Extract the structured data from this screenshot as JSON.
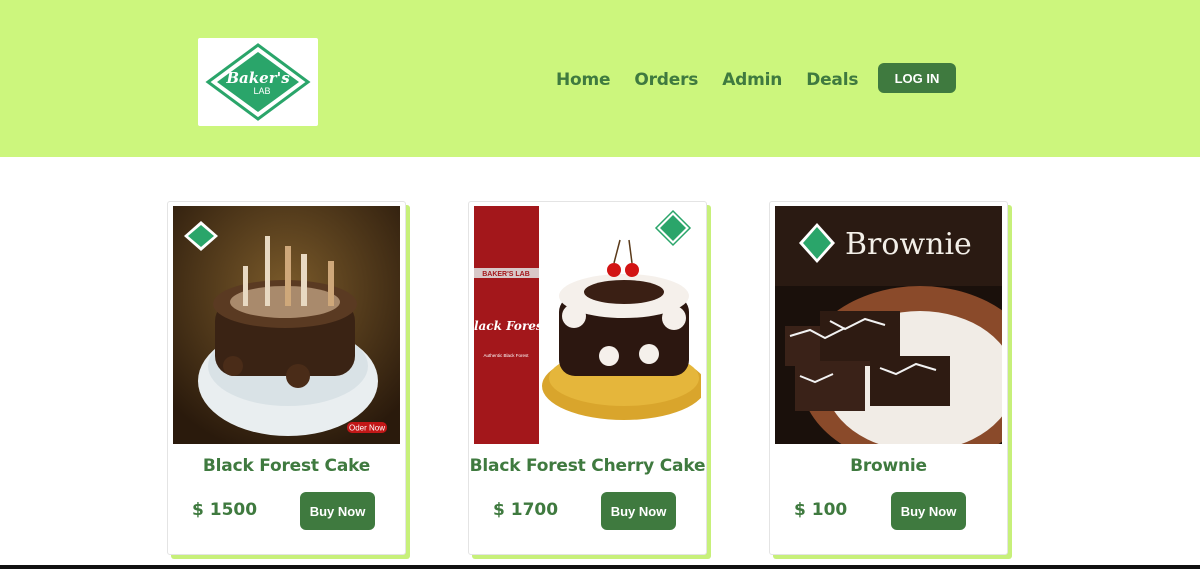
{
  "brand": {
    "logo_line1": "Baker's",
    "logo_line2": "LAB"
  },
  "nav": [
    {
      "label": "Home"
    },
    {
      "label": "Orders"
    },
    {
      "label": "Admin"
    },
    {
      "label": "Deals"
    }
  ],
  "login_label": "LOG IN",
  "colors": {
    "header_bg": "#ccf67d",
    "accent": "#3f7a3f",
    "card_shadow": "#c7f07a"
  },
  "products": [
    {
      "name": "Black Forest Cake",
      "price": "$ 1500",
      "buy_label": "Buy Now",
      "image": {
        "badge": "Oder Now"
      }
    },
    {
      "name": "Black Forest Cherry Cake",
      "price": "$ 1700",
      "buy_label": "Buy Now",
      "image": {
        "banner_brand": "BAKER'S LAB",
        "banner_title": "Black Forest",
        "banner_sub": "Authentic Black Forest"
      }
    },
    {
      "name": "Brownie",
      "price": "$ 100",
      "buy_label": "Buy Now",
      "image": {
        "title": "Brownie"
      }
    }
  ]
}
